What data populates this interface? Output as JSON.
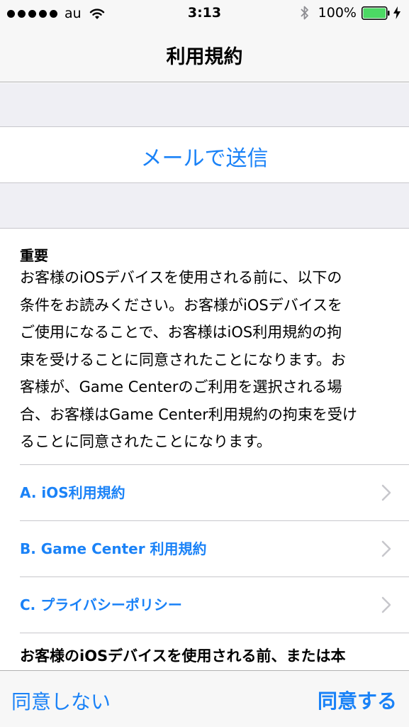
{
  "status_bar": {
    "carrier": "au",
    "time": "3:13",
    "battery_percent": "100%",
    "battery_level": 1.0,
    "signal_bars": 5
  },
  "nav": {
    "title": "利用規約"
  },
  "mail_button": {
    "label": "メールで送信"
  },
  "content": {
    "heading": "重要",
    "lines": [
      "お客様のiOSデバイスを使用される前に、以下の",
      "条件をお読みください。お客様がiOSデバイスを",
      "ご使用になることで、お客様はiOS利用規約の拘",
      "束を受けることに同意されたことになります。お",
      "客様が、Game Centerのご利用を選択される場",
      "合、お客様はGame Center利用規約の拘束を受け",
      "ることに同意されたことになります。"
    ],
    "links": [
      {
        "label": "A. iOS利用規約"
      },
      {
        "label": "B. Game Center 利用規約"
      },
      {
        "label": "C. プライバシーポリシー"
      }
    ],
    "trailing_text": "お客様のiOSデバイスを使用される前、または本"
  },
  "toolbar": {
    "disagree_label": "同意しない",
    "agree_label": "同意する"
  },
  "colors": {
    "accent": "#1a82f7",
    "battery": "#4cd964",
    "grouped_background": "#efeff4",
    "bar_background": "#f7f7f7",
    "separator": "#c8c7cc"
  },
  "icons": {
    "wifi": "wifi-icon",
    "bluetooth": "bluetooth-icon",
    "battery": "battery-icon",
    "charging": "charging-icon",
    "chevron": "chevron-right-icon"
  }
}
